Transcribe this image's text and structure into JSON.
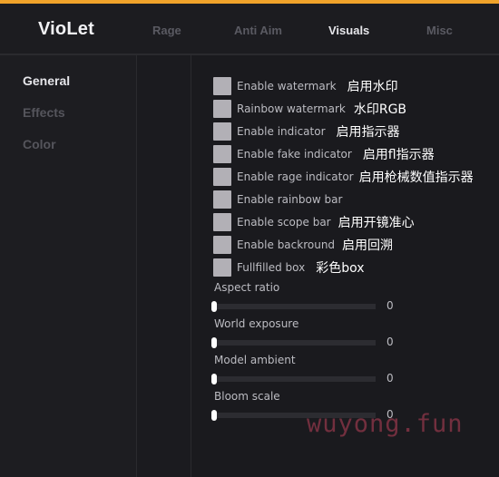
{
  "app": {
    "title": "VioLet"
  },
  "nav": {
    "tabs": [
      {
        "label": "Rage",
        "active": false
      },
      {
        "label": "Anti Aim",
        "active": false
      },
      {
        "label": "Visuals",
        "active": true
      },
      {
        "label": "Misc",
        "active": false
      }
    ]
  },
  "sidebar": {
    "items": [
      {
        "label": "General",
        "active": true
      },
      {
        "label": "Effects",
        "active": false
      },
      {
        "label": "Color",
        "active": false
      }
    ]
  },
  "options": [
    {
      "label": "Enable watermark",
      "note": "启用水印",
      "checked": false
    },
    {
      "label": "Rainbow watermark",
      "note": "水印RGB",
      "checked": false
    },
    {
      "label": "Enable indicator",
      "note": "启用指示器",
      "checked": false
    },
    {
      "label": "Enable fake indicator",
      "note": "启用fl指示器",
      "checked": false
    },
    {
      "label": "Enable rage indicator",
      "note": "启用枪械数值指示器",
      "checked": false
    },
    {
      "label": "Enable rainbow bar",
      "note": "",
      "checked": false
    },
    {
      "label": "Enable scope bar",
      "note": "启用开镜准心",
      "checked": false
    },
    {
      "label": "Enable backround",
      "note": "启用回溯",
      "checked": false
    },
    {
      "label": "Fullfilled box",
      "note": "彩色box",
      "checked": false
    }
  ],
  "sliders": [
    {
      "label": "Aspect ratio",
      "value": "0",
      "fraction": 0
    },
    {
      "label": "World exposure",
      "value": "0",
      "fraction": 0
    },
    {
      "label": "Model ambient",
      "value": "0",
      "fraction": 0
    },
    {
      "label": "Bloom scale",
      "value": "0",
      "fraction": 0
    }
  ],
  "watermark": {
    "text": "wuyong.fun"
  },
  "colors": {
    "accent": "#f0a32a",
    "checkbox": "#b2b0b6",
    "background": "#1a1a1e",
    "watermark": "#8b3548"
  }
}
